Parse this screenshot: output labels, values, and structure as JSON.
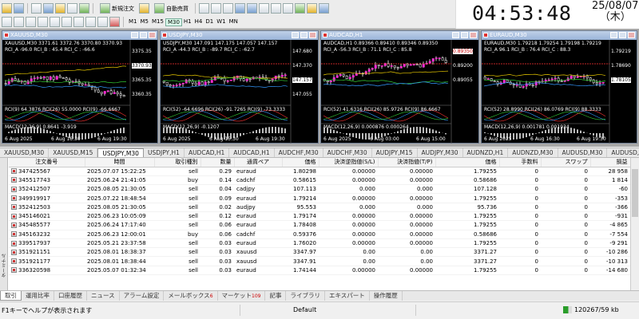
{
  "toolbar": {
    "new_order": "新規注文",
    "autotrading": "自動売買",
    "timeframes": [
      "M1",
      "M5",
      "M15",
      "M30",
      "H1",
      "H4",
      "D1",
      "W1",
      "MN"
    ],
    "active_timeframe": "M30"
  },
  "clock": {
    "time": "04:53:48",
    "date": "25/08/07",
    "weekday": "（木）"
  },
  "charts": [
    {
      "title": "XAUUSD,M30",
      "info": "XAUUSD,M30 3371.61 3372.76 3370.80 3370.93",
      "info2": "RCI_A -96.0  RCI_B : 45.4  RCI_C : -66.6",
      "prices": [
        "3375.35",
        "3370.93",
        "3365.35",
        "3360.35"
      ],
      "ind": "RCI(9) 64.3876  RCI(26) 55.0000  RCI(9) -66.6667",
      "ind2": "MACD(12,26,9) 0.8641 -3.919",
      "dates": [
        "6 Aug 2025",
        "6 Aug 16:30",
        "6 Aug 19:30"
      ],
      "accent": "#ff3333"
    },
    {
      "title": "USDJPY,M30",
      "info": "USDJPY,M30 147.091 147.175 147.057 147.157",
      "info2": "RCI_A -44.3  RCI_B : -89.7  RCI_C : -62.7",
      "prices": [
        "147.680",
        "147.370",
        "147.157",
        "147.055"
      ],
      "ind": "RCI(52) -64.6696  RCI(26) -91.7265  RCI(9) -73.3333",
      "ind2": "MACD(12,26,9) -0.1207",
      "dates": [
        "6 Aug 2025",
        "6 Aug 15:30",
        "6 Aug 19:30"
      ],
      "accent": "#ff3333"
    },
    {
      "title": "AUDCAD,H1",
      "info": "AUDCAD,H1 0.89366 0.89410 0.89346 0.89350",
      "info2": "RCI_A -56.3  RCI_B : 71.1  RCI_C : 85.8",
      "prices": [
        "0.89350",
        "0.89200",
        "0.89055"
      ],
      "ind": "RCI(52) 41.6316  RCI(26) 85.9726  RCI(9) 86.6667",
      "ind2": "MACD(12,26,9) 0.000876 0.000264",
      "dates": [
        "6 Aug 2025",
        "6 Aug 03:00",
        "6 Aug 15:00"
      ],
      "accent": "#ff3333"
    },
    {
      "title": "EURAUD,M30",
      "info": "EURAUD,M30 1.79218 1.79254 1.79198 1.79219",
      "info2": "RCI_A 96.1  RCI_B : 76.4  RCI_C : 88.3",
      "prices": [
        "1.79219",
        "1.78690",
        "1.78105"
      ],
      "ind": "RCI(52) 28.8990  RCI(26) 86.0769  RCI(9) 88.3333",
      "ind2": "MACD(12,26,9) 0.001781 0.001934",
      "dates": [
        "6 Aug 2025",
        "6 Aug 16:30",
        "6 Aug 19:30"
      ],
      "accent": "#ff3333"
    }
  ],
  "symbol_tabs": [
    "XAUUSD,M30",
    "XAUUSD,M15",
    "USDJPY,M30",
    "USDJPY,H1",
    "AUDCAD,H1",
    "AUDCAD,H1",
    "AUDCHF,M30",
    "AUDCHF,M30",
    "AUDJPY,M15",
    "AUDJPY,M30",
    "AUDNZD,H1",
    "AUDNZD,M30",
    "AUDUSD,M30",
    "AUDUSD,F"
  ],
  "active_symbol_tab": 2,
  "terminal": {
    "side_label": "ターミナル",
    "columns": [
      "注文番号",
      "時間",
      "取引種別",
      "数量",
      "通貨ペア",
      "価格",
      "決済逆指値(S/L)",
      "決済指値(T/P)",
      "価格",
      "手数料",
      "スワップ",
      "損益"
    ],
    "rows": [
      [
        "347425567",
        "2025.07.07 15:22:25",
        "sell",
        "0.29",
        "euraud",
        "1.80298",
        "0.00000",
        "0.00000",
        "1.79255",
        "0",
        "0",
        "28 958"
      ],
      [
        "345517743",
        "2025.06.24 21:41:05",
        "buy",
        "0.14",
        "cadchf",
        "0.58615",
        "0.00000",
        "0.00000",
        "0.58686",
        "0",
        "0",
        "1 814"
      ],
      [
        "352412507",
        "2025.08.05 21:30:05",
        "sell",
        "0.04",
        "cadjpy",
        "107.113",
        "0.000",
        "0.000",
        "107.128",
        "0",
        "0",
        "-60"
      ],
      [
        "349919917",
        "2025.07.22 18:48:54",
        "sell",
        "0.09",
        "euraud",
        "1.79214",
        "0.00000",
        "0.00000",
        "1.79255",
        "0",
        "0",
        "-353"
      ],
      [
        "352412503",
        "2025.08.05 21:30:05",
        "sell",
        "0.02",
        "audjpy",
        "95.553",
        "0.000",
        "0.000",
        "95.736",
        "0",
        "0",
        "-366"
      ],
      [
        "345146021",
        "2025.06.23 10:05:09",
        "sell",
        "0.12",
        "euraud",
        "1.79174",
        "0.00000",
        "0.00000",
        "1.79255",
        "0",
        "0",
        "-931"
      ],
      [
        "345485577",
        "2025.06.24 17:17:40",
        "sell",
        "0.06",
        "euraud",
        "1.78408",
        "0.00000",
        "0.00000",
        "1.79255",
        "0",
        "0",
        "-4 865"
      ],
      [
        "345163232",
        "2025.06.23 12:00:01",
        "buy",
        "0.06",
        "cadchf",
        "0.59376",
        "0.00000",
        "0.00000",
        "0.58686",
        "0",
        "0",
        "-7 554"
      ],
      [
        "339517937",
        "2025.05.21 23:37:58",
        "sell",
        "0.03",
        "euraud",
        "1.76020",
        "0.00000",
        "0.00000",
        "1.79255",
        "0",
        "0",
        "-9 291"
      ],
      [
        "351921151",
        "2025.08.01 18:38:37",
        "sell",
        "0.03",
        "xauusd",
        "3347.97",
        "0.00",
        "0.00",
        "3371.27",
        "0",
        "0",
        "-10 286"
      ],
      [
        "351921177",
        "2025.08.01 18:38:44",
        "sell",
        "0.03",
        "xauusd",
        "3347.91",
        "0.00",
        "0.00",
        "3371.27",
        "0",
        "0",
        "-10 313"
      ],
      [
        "336320598",
        "2025.05.07 01:32:34",
        "sell",
        "0.03",
        "euraud",
        "1.74144",
        "0.00000",
        "0.00000",
        "1.79255",
        "0",
        "0",
        "-14 680"
      ]
    ]
  },
  "bottom_tabs": [
    {
      "label": "取引",
      "badge": ""
    },
    {
      "label": "運用比率",
      "badge": ""
    },
    {
      "label": "口座履歴",
      "badge": ""
    },
    {
      "label": "ニュース",
      "badge": ""
    },
    {
      "label": "アラーム設定",
      "badge": ""
    },
    {
      "label": "メールボックス",
      "badge": "6"
    },
    {
      "label": "マーケット",
      "badge": "109"
    },
    {
      "label": "記事",
      "badge": ""
    },
    {
      "label": "ライブラリ",
      "badge": ""
    },
    {
      "label": "エキスパート",
      "badge": ""
    },
    {
      "label": "操作履歴",
      "badge": ""
    }
  ],
  "status": {
    "help": "F1キーでヘルプが表示されます",
    "profile": "Default",
    "traffic": "120267/59 kb"
  }
}
